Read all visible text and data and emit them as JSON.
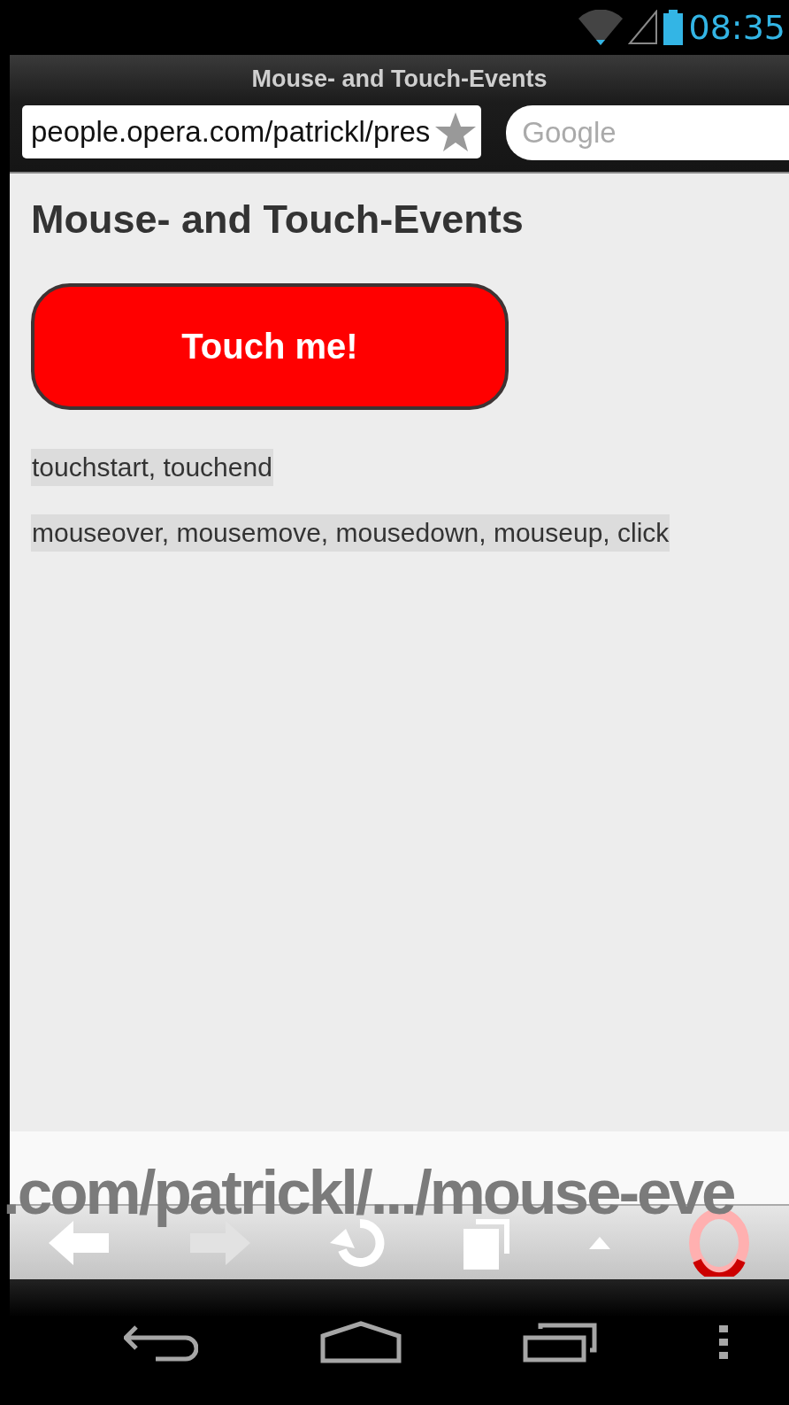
{
  "status_bar": {
    "time": "08:35"
  },
  "browser": {
    "title": "Mouse- and Touch-Events",
    "address": "people.opera.com/patrickl/pres",
    "search": {
      "placeholder": "Google"
    }
  },
  "page": {
    "heading": "Mouse- and Touch-Events",
    "button": "Touch me!",
    "event_logs": [
      "touchstart, touchend",
      "mouseover, mousemove, mousedown, mouseup, click"
    ]
  },
  "url_overlay": ".com/patrickl/.../mouse-eve",
  "toolbar": [
    {
      "kind": "back",
      "disabled": false
    },
    {
      "kind": "forward",
      "disabled": true
    },
    {
      "kind": "reload",
      "disabled": false
    },
    {
      "kind": "tabs",
      "disabled": false
    },
    {
      "kind": "up",
      "disabled": false
    },
    {
      "kind": "opera",
      "disabled": false
    }
  ],
  "nav_bar": [
    {
      "kind": "back"
    },
    {
      "kind": "home"
    },
    {
      "kind": "recents"
    },
    {
      "kind": "menu"
    }
  ]
}
